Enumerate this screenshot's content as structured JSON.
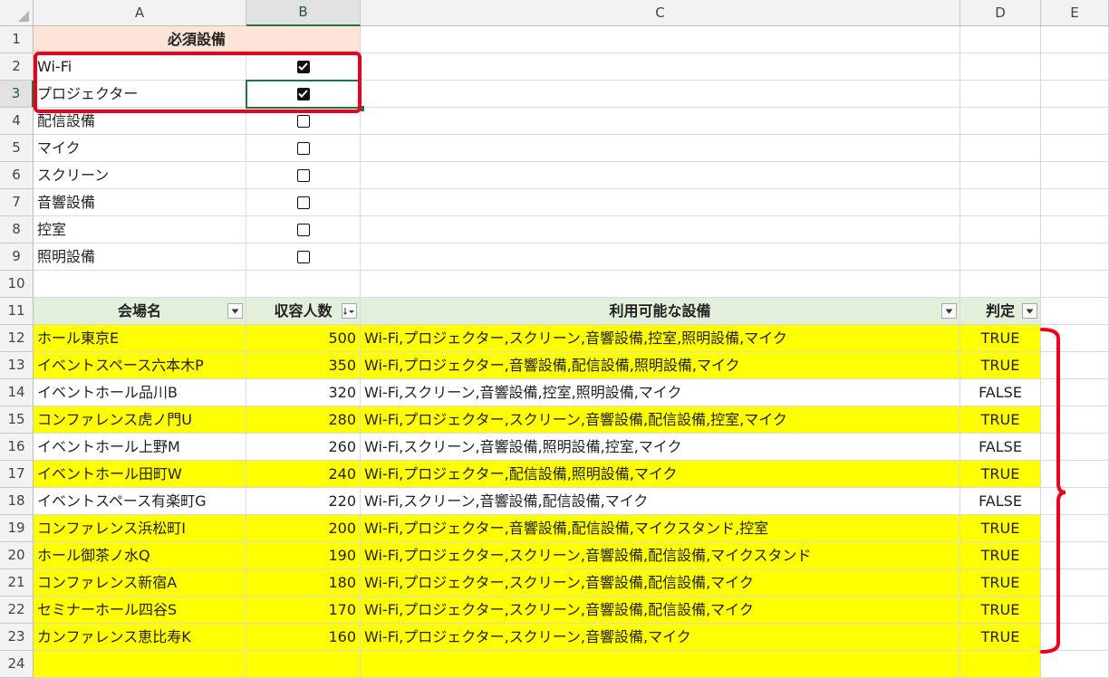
{
  "columns": [
    "A",
    "B",
    "C",
    "D",
    "E"
  ],
  "selected_column": "B",
  "selected_row": "3",
  "equipment_header": "必須設備",
  "equipment": [
    {
      "row": "2",
      "name": "Wi-Fi",
      "checked": true
    },
    {
      "row": "3",
      "name": "プロジェクター",
      "checked": true
    },
    {
      "row": "4",
      "name": "配信設備",
      "checked": false
    },
    {
      "row": "5",
      "name": "マイク",
      "checked": false
    },
    {
      "row": "6",
      "name": "スクリーン",
      "checked": false
    },
    {
      "row": "7",
      "name": "音響設備",
      "checked": false
    },
    {
      "row": "8",
      "name": "控室",
      "checked": false
    },
    {
      "row": "9",
      "name": "照明設備",
      "checked": false
    }
  ],
  "table_headers": {
    "venue": "会場名",
    "capacity": "収容人数",
    "facilities": "利用可能な設備",
    "verdict": "判定"
  },
  "table_rows": [
    {
      "row": "12",
      "venue": "ホール東京E",
      "capacity": "500",
      "facilities": "Wi-Fi,プロジェクター,スクリーン,音響設備,控室,照明設備,マイク",
      "verdict": "TRUE"
    },
    {
      "row": "13",
      "venue": "イベントスペース六本木P",
      "capacity": "350",
      "facilities": "Wi-Fi,プロジェクター,音響設備,配信設備,照明設備,マイク",
      "verdict": "TRUE"
    },
    {
      "row": "14",
      "venue": "イベントホール品川B",
      "capacity": "320",
      "facilities": "Wi-Fi,スクリーン,音響設備,控室,照明設備,マイク",
      "verdict": "FALSE"
    },
    {
      "row": "15",
      "venue": "コンファレンス虎ノ門U",
      "capacity": "280",
      "facilities": "Wi-Fi,プロジェクター,スクリーン,音響設備,配信設備,控室,マイク",
      "verdict": "TRUE"
    },
    {
      "row": "16",
      "venue": "イベントホール上野M",
      "capacity": "260",
      "facilities": "Wi-Fi,スクリーン,音響設備,照明設備,控室,マイク",
      "verdict": "FALSE"
    },
    {
      "row": "17",
      "venue": "イベントホール田町W",
      "capacity": "240",
      "facilities": "Wi-Fi,プロジェクター,配信設備,照明設備,マイク",
      "verdict": "TRUE"
    },
    {
      "row": "18",
      "venue": "イベントスペース有楽町G",
      "capacity": "220",
      "facilities": "Wi-Fi,スクリーン,音響設備,配信設備,マイク",
      "verdict": "FALSE"
    },
    {
      "row": "19",
      "venue": "コンファレンス浜松町I",
      "capacity": "200",
      "facilities": "Wi-Fi,プロジェクター,音響設備,配信設備,マイクスタンド,控室",
      "verdict": "TRUE"
    },
    {
      "row": "20",
      "venue": "ホール御茶ノ水Q",
      "capacity": "190",
      "facilities": "Wi-Fi,プロジェクター,スクリーン,音響設備,配信設備,マイクスタンド",
      "verdict": "TRUE"
    },
    {
      "row": "21",
      "venue": "コンファレンス新宿A",
      "capacity": "180",
      "facilities": "Wi-Fi,プロジェクター,スクリーン,音響設備,配信設備,マイク",
      "verdict": "TRUE"
    },
    {
      "row": "22",
      "venue": "セミナーホール四谷S",
      "capacity": "170",
      "facilities": "Wi-Fi,プロジェクター,スクリーン,音響設備,配信設備,マイク",
      "verdict": "TRUE"
    },
    {
      "row": "23",
      "venue": "カンファレンス恵比寿K",
      "capacity": "160",
      "facilities": "Wi-Fi,プロジェクター,スクリーン,音響設備,マイク",
      "verdict": "TRUE"
    }
  ],
  "colors": {
    "highlight": "#ffff00",
    "equipment_header_bg": "#fce4d6",
    "table_header_bg": "#e2efda",
    "annotation": "#e8001c",
    "selection": "#217346"
  }
}
